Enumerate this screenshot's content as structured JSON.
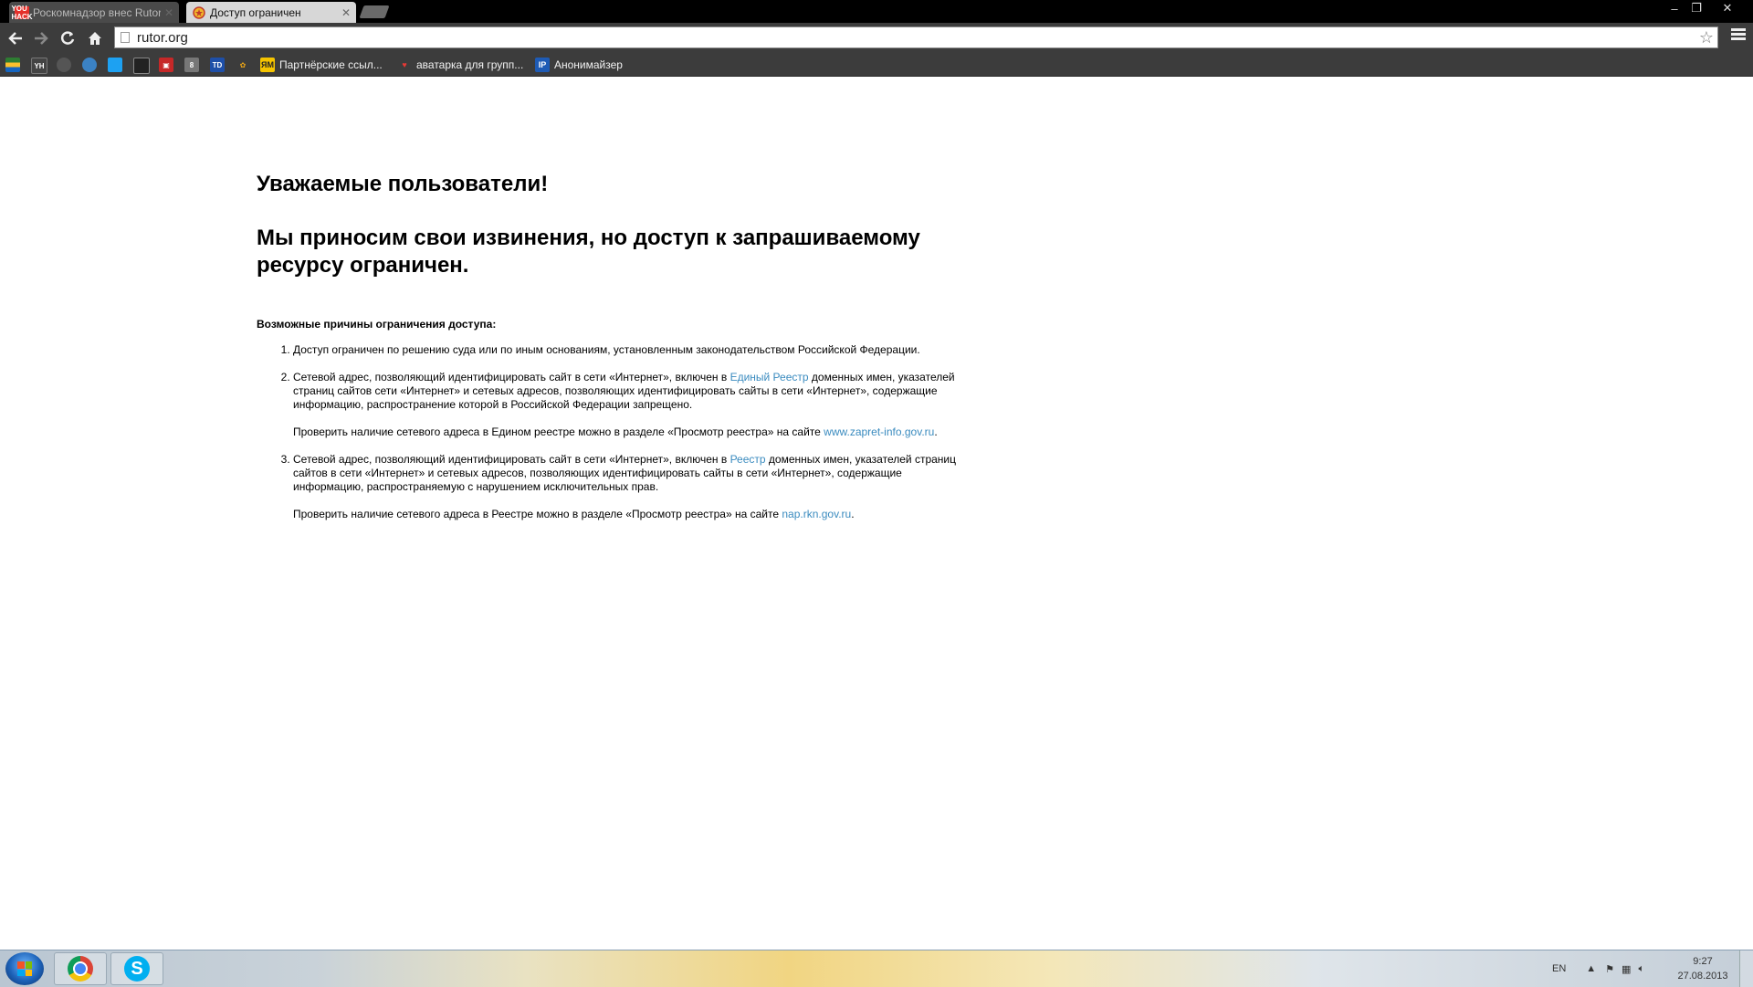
{
  "browser": {
    "tabs": [
      {
        "title": "Роскомнадзор внес Rutor",
        "favicon_text": "YOU HACK",
        "active": false
      },
      {
        "title": "Доступ ограничен",
        "active": true
      }
    ],
    "window_controls": {
      "minimize": "–",
      "restore": "❐",
      "close": "✕"
    },
    "address": {
      "url": "rutor.org"
    },
    "bookmarks": [
      {
        "label": "Партнёрские ссыл...",
        "icon": "ЯМ"
      },
      {
        "label": "аватарка для групп...",
        "icon": "♥"
      },
      {
        "label": "Анонимайзер",
        "icon": "IP"
      }
    ]
  },
  "page": {
    "greeting": "Уважаемые пользователи!",
    "apology": "Мы приносим свои извинения, но доступ к запрашиваемому ресурсу ограничен.",
    "reasons_title": "Возможные причины ограничения доступа:",
    "reasons": [
      {
        "text": "Доступ ограничен  по решению суда или по иным основаниям, установленным законодательством Российской Федерации."
      },
      {
        "text_before": "Сетевой адрес, позволяющий идентифицировать сайт в сети «Интернет», включен в ",
        "link": "Единый Реестр",
        "text_after": " доменных имен, указателей страниц сайтов сети «Интернет» и сетевых адресов, позволяющих идентифицировать сайты в сети «Интернет», содержащие информацию, распространение которой в Российской Федерации запрещено.",
        "check_before": "Проверить наличие сетевого адреса в Едином реестре можно в разделе «Просмотр реестра» на сайте ",
        "check_link": "www.zapret-info.gov.ru",
        "check_after": "."
      },
      {
        "text_before": "Сетевой адрес, позволяющий идентифицировать сайт в сети «Интернет», включен в ",
        "link": "Реестр",
        "text_after": " доменных имен, указателей страниц сайтов в сети «Интернет» и сетевых адресов, позволяющих идентифицировать сайты в сети «Интернет», содержащие информацию, распространяемую с нарушением исключительных прав.",
        "check_before": "Проверить наличие сетевого адреса в Реестре можно в разделе «Просмотр реестра» на сайте ",
        "check_link": "nap.rkn.gov.ru",
        "check_after": "."
      }
    ],
    "link_color": "#3a8bbf"
  },
  "taskbar": {
    "apps": [
      "chrome",
      "skype"
    ],
    "tray": {
      "language": "EN",
      "time": "9:27",
      "date": "27.08.2013"
    }
  }
}
